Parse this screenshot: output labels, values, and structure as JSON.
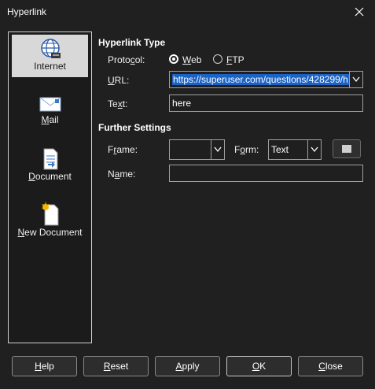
{
  "window": {
    "title": "Hyperlink"
  },
  "sidebar": {
    "items": [
      {
        "label": "Internet",
        "icon": "globe-icon",
        "selected": true
      },
      {
        "label": "Mail",
        "icon": "envelope-icon",
        "selected": false
      },
      {
        "label": "Document",
        "icon": "document-icon",
        "selected": false
      },
      {
        "label": "New Document",
        "icon": "new-document-icon",
        "selected": false
      }
    ]
  },
  "hyperlink_type": {
    "heading": "Hyperlink Type",
    "protocol_label": "Protocol:",
    "web_label": "Web",
    "ftp_label": "FTP",
    "selected_protocol": "Web",
    "url_label": "URL:",
    "url_value": "https://superuser.com/questions/428299/h",
    "text_label": "Text:",
    "text_value": "here"
  },
  "further_settings": {
    "heading": "Further Settings",
    "frame_label": "Frame:",
    "frame_value": "",
    "form_label": "Form:",
    "form_value": "Text",
    "name_label": "Name:",
    "name_value": ""
  },
  "buttons": {
    "help": "Help",
    "reset": "Reset",
    "apply": "Apply",
    "ok": "OK",
    "close": "Close"
  },
  "colors": {
    "background": "#202020",
    "selection": "#1a62c5",
    "sidebar_selected": "#d8d8d8"
  }
}
